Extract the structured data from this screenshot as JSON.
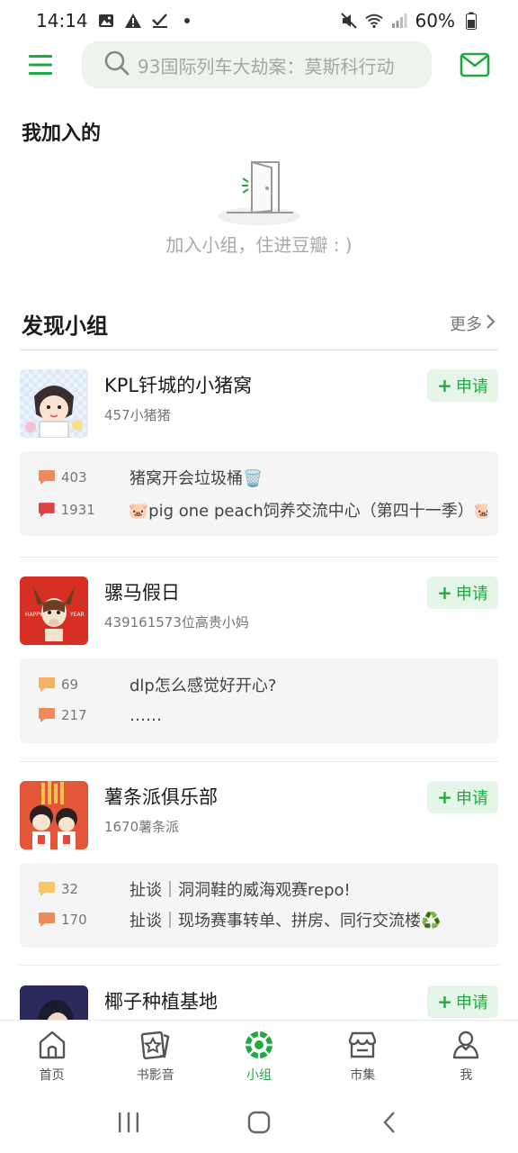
{
  "status_bar": {
    "time": "14:14",
    "battery": "60%",
    "icons": [
      "image-icon",
      "warning-icon",
      "check-icon",
      "dot-icon",
      "mute-icon",
      "wifi-icon",
      "signal-icon",
      "battery-icon"
    ]
  },
  "header": {
    "search_placeholder": "93国际列车大劫案：莫斯科行动",
    "icons": [
      "menu-icon",
      "search-icon",
      "mail-icon"
    ]
  },
  "joined": {
    "title": "我加入的",
    "empty_text": "加入小组，住进豆瓣 : )"
  },
  "discover": {
    "title": "发现小组",
    "more_label": "更多",
    "apply_label": "申请",
    "groups": [
      {
        "name": "KPL钎城的小猪窝",
        "members": "457小猪猪",
        "topics": [
          {
            "count": "403",
            "text": "猪窝开会垃圾桶🗑️",
            "color": "#f08a5d"
          },
          {
            "count": "1931",
            "text": "🐷pig one peach饲养交流中心（第四十一季）🐷",
            "color": "#e04343"
          }
        ]
      },
      {
        "name": "骡马假日",
        "members": "439161573位高贵小妈",
        "topics": [
          {
            "count": "69",
            "text": "dlp怎么感觉好开心?",
            "color": "#f5b165"
          },
          {
            "count": "217",
            "text": "……",
            "color": "#f08a5d"
          }
        ]
      },
      {
        "name": "薯条派俱乐部",
        "members": "1670薯条派",
        "topics": [
          {
            "count": "32",
            "text": "扯谈｜洞洞鞋的威海观赛repo!",
            "color": "#f7c86a"
          },
          {
            "count": "170",
            "text": "扯谈｜现场赛事转单、拼房、同行交流楼♻️",
            "color": "#f08a5d"
          }
        ]
      },
      {
        "name": "椰子种植基地",
        "members": "",
        "topics": []
      }
    ]
  },
  "bottom_nav": {
    "items": [
      {
        "label": "首页",
        "icon": "home-icon",
        "active": false
      },
      {
        "label": "书影音",
        "icon": "book-movie-music-icon",
        "active": false
      },
      {
        "label": "小组",
        "icon": "group-icon",
        "active": true
      },
      {
        "label": "市集",
        "icon": "market-icon",
        "active": false
      },
      {
        "label": "我",
        "icon": "profile-icon",
        "active": false
      }
    ]
  },
  "colors": {
    "accent": "#1fa940",
    "apply_bg": "#e5f5e8",
    "search_bg": "#eef3ee",
    "topic_bg": "#f5f5f5"
  }
}
